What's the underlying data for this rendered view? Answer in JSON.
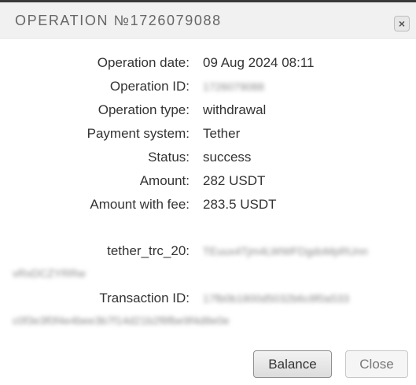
{
  "dialog": {
    "title": "OPERATION №1726079088",
    "close_icon": "×"
  },
  "details": [
    {
      "label": "Operation date:",
      "value": "09 Aug 2024 08:11"
    },
    {
      "label": "Operation ID:",
      "value": "1726079088"
    },
    {
      "label": "Operation type:",
      "value": "withdrawal"
    },
    {
      "label": "Payment system:",
      "value": "Tether"
    },
    {
      "label": "Status:",
      "value": "success"
    },
    {
      "label": "Amount:",
      "value": "282 USDT"
    },
    {
      "label": "Amount with fee:",
      "value": "283.5 USDT"
    }
  ],
  "wallet": {
    "label": "tether_trc_20:",
    "value_line1": "TEuux4Tjm4LWWFDgdoMpRUnn",
    "value_line2": "vRxDCZYRRw"
  },
  "transaction": {
    "label": "Transaction ID:",
    "value_line1": "17fb0b1800d5032b6c8f0a533",
    "value_line2": "c0f3e3f0f4e4bee3b7f14d21b2f8fbe9f4d8e0e"
  },
  "buttons": {
    "balance": "Balance",
    "close": "Close"
  }
}
